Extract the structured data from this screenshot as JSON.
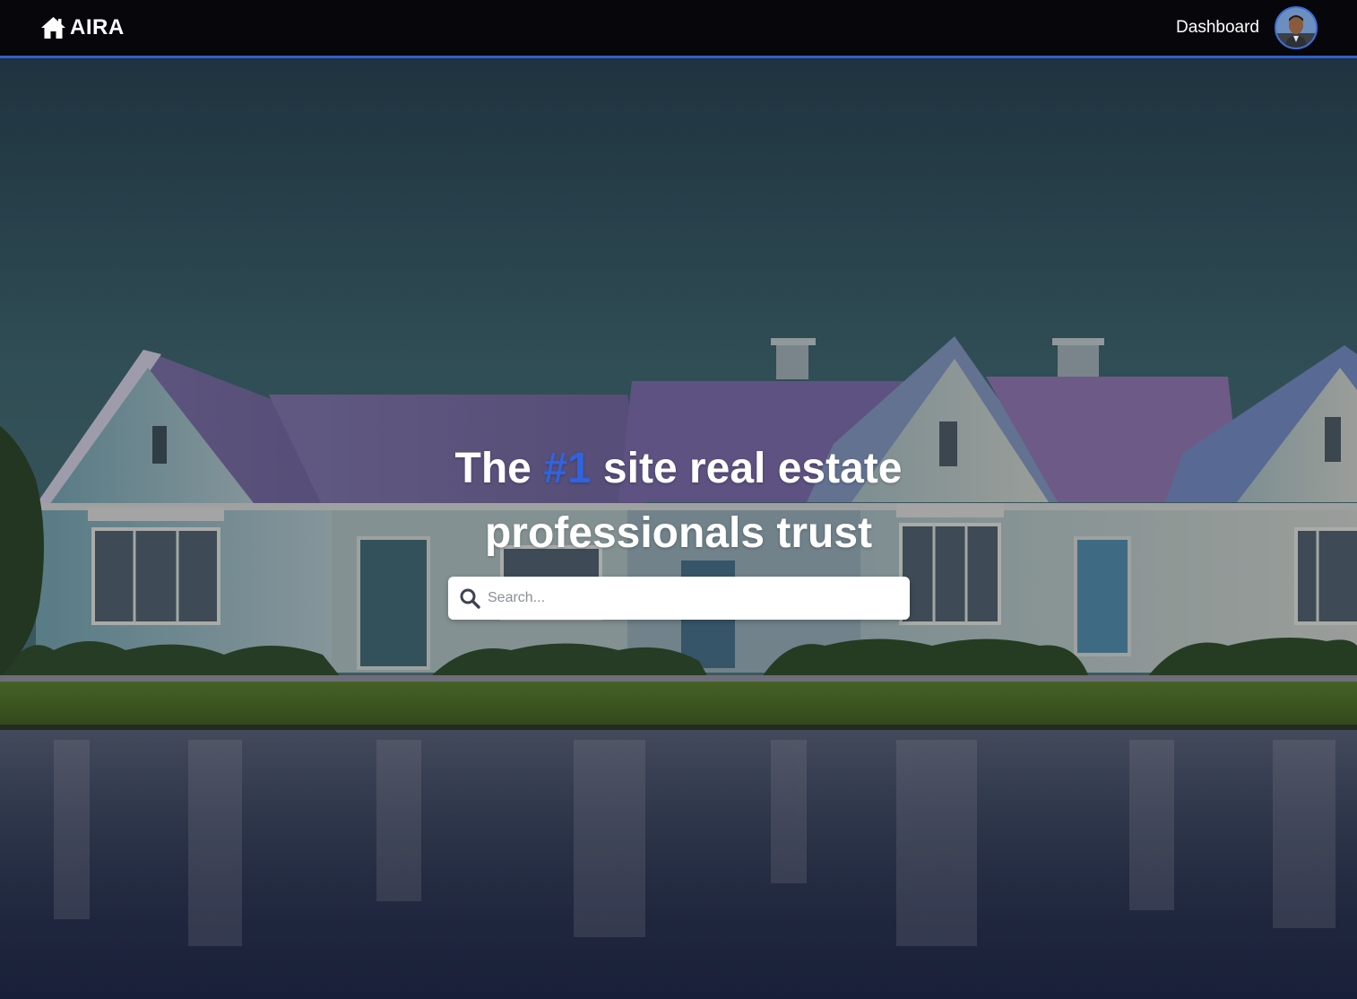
{
  "navbar": {
    "brand": "AIRA",
    "dashboard_label": "Dashboard",
    "accent_color": "#2f5fd0"
  },
  "hero": {
    "headline_prefix": "The ",
    "headline_accent": "#1",
    "headline_suffix": " site real estate professionals trust",
    "accent_color": "#2f63e0"
  },
  "search": {
    "placeholder": "Search...",
    "value": ""
  },
  "icons": {
    "brand": "home-icon",
    "search": "search-icon",
    "avatar": "user-avatar"
  }
}
